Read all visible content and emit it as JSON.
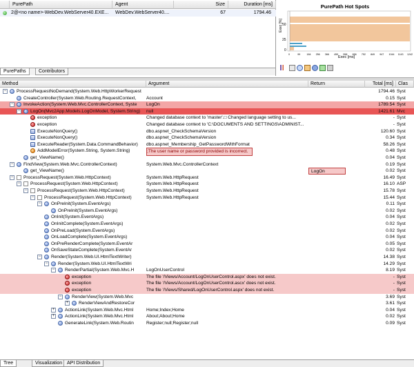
{
  "purepaths": {
    "columns": [
      "PurePath",
      "Agent",
      "Size",
      "Duration [ms]"
    ],
    "row": {
      "path": "2@<no name>-WebDev.WebServer40.EXE...",
      "agent": "WebDev.WebServer40....",
      "size": "67",
      "duration": "1794.46"
    },
    "tabs": [
      "PurePaths",
      "Contributors"
    ]
  },
  "hotspots": {
    "title": "PurePath Hot Spots",
    "ylabel": "Exec [%]",
    "xlabel": "Exec [ms]",
    "x_ticks": [
      "0",
      "99",
      "184",
      "256",
      "366",
      "459",
      "558",
      "656",
      "752",
      "849",
      "947",
      "1044",
      "1143",
      "1242"
    ]
  },
  "tree": {
    "columns": [
      "Method",
      "Argument",
      "Return",
      "Total [ms]",
      "Clas"
    ],
    "rows": [
      {
        "level": 0,
        "exp": "-",
        "icon": "ic",
        "method": "ProcessRequestNoDemand(System.Web.HttpWorkerRequest",
        "arg": "",
        "ret": "",
        "total": "1794.46",
        "cls": "Syst",
        "style": ""
      },
      {
        "level": 1,
        "exp": "",
        "icon": "ic",
        "method": "CreateController(System.Web.Routing.RequestContext,",
        "arg": "Account",
        "ret": "",
        "total": "0.15",
        "cls": "Syst",
        "style": ""
      },
      {
        "level": 1,
        "exp": "-",
        "icon": "ic",
        "method": "InvokeAction(System.Web.Mvc.ControllerContext, Syste",
        "arg": "LogOn",
        "ret": "",
        "total": "1789.54",
        "cls": "Syst",
        "style": "pink"
      },
      {
        "level": 2,
        "exp": "-",
        "icon": "ic",
        "method": "LogOn(Mvc2App.Models.LogOnModel, System.String)",
        "arg": "null",
        "ret": "",
        "total": "1421.61",
        "cls": "Mvc",
        "style": "sel"
      },
      {
        "level": 3,
        "exp": "",
        "icon": "ic-ex",
        "method": "exception",
        "arg": "Changed database context to 'master'.□ Changed language setting to us...",
        "ret": "",
        "total": "-",
        "cls": "Syst",
        "style": ""
      },
      {
        "level": 3,
        "exp": "",
        "icon": "ic-ex",
        "method": "exception",
        "arg": "Changed database context to 'C:\\DOCUMENTS AND SETTINGS\\ADMINIST...",
        "ret": "",
        "total": "-",
        "cls": "Syst",
        "style": ""
      },
      {
        "level": 3,
        "exp": "",
        "icon": "ic-db",
        "method": "ExecuteNonQuery()",
        "arg": "dbo.aspnet_CheckSchemaVersion",
        "ret": "",
        "total": "120.60",
        "cls": "Syst",
        "style": ""
      },
      {
        "level": 3,
        "exp": "",
        "icon": "ic-db",
        "method": "ExecuteNonQuery()",
        "arg": "dbo.aspnet_CheckSchemaVersion",
        "ret": "",
        "total": "0.34",
        "cls": "Syst",
        "style": ""
      },
      {
        "level": 3,
        "exp": "",
        "icon": "ic-db",
        "method": "ExecuteReader(System.Data.CommandBehavior)",
        "arg": "dbo.aspnet_Membership_GetPasswordWithFormat",
        "ret": "",
        "total": "58.26",
        "cls": "Syst",
        "style": ""
      },
      {
        "level": 3,
        "exp": "",
        "icon": "ic-err",
        "method": "AddModelError(System.String, System.String)",
        "arg": ";The user name or password provided is incorrect.",
        "ret": "",
        "total": "0.48",
        "cls": "Syst",
        "style": "argbox"
      },
      {
        "level": 2,
        "exp": "",
        "icon": "ic",
        "method": "get_ViewName()",
        "arg": "",
        "ret": "",
        "total": "0.04",
        "cls": "Syst",
        "style": ""
      },
      {
        "level": 1,
        "exp": "-",
        "icon": "ic",
        "method": "FindView(System.Web.Mvc.ControllerContext)",
        "arg": "System.Web.Mvc.ControllerContext",
        "ret": "",
        "total": "0.19",
        "cls": "Syst",
        "style": ""
      },
      {
        "level": 2,
        "exp": "",
        "icon": "ic",
        "method": "get_ViewName()",
        "arg": "",
        "ret": "LogOn",
        "total": "0.02",
        "cls": "Syst",
        "style": "retbox"
      },
      {
        "level": 1,
        "exp": "-",
        "icon": "ic-pg",
        "method": "ProcessRequest(System.Web.HttpContext)",
        "arg": "System.Web.HttpRequest",
        "ret": "",
        "total": "16.49",
        "cls": "Syst",
        "style": ""
      },
      {
        "level": 2,
        "exp": "-",
        "icon": "ic-pg",
        "method": "ProcessRequest(System.Web.HttpContext)",
        "arg": "System.Web.HttpRequest",
        "ret": "",
        "total": "16.10",
        "cls": "ASP",
        "style": ""
      },
      {
        "level": 3,
        "exp": "-",
        "icon": "ic-pg",
        "method": "ProcessRequest(System.Web.HttpContext)",
        "arg": "System.Web.HttpRequest",
        "ret": "",
        "total": "15.78",
        "cls": "Syst",
        "style": ""
      },
      {
        "level": 4,
        "exp": "-",
        "icon": "ic-pg",
        "method": "ProcessRequest(System.Web.HttpContext)",
        "arg": "System.Web.HttpRequest",
        "ret": "",
        "total": "15.44",
        "cls": "Syst",
        "style": ""
      },
      {
        "level": 5,
        "exp": "-",
        "icon": "ic",
        "method": "OnPreInit(System.EventArgs)",
        "arg": "",
        "ret": "",
        "total": "0.11",
        "cls": "Syst",
        "style": ""
      },
      {
        "level": 6,
        "exp": "",
        "icon": "ic",
        "method": "OnPreInit(System.EventArgs)",
        "arg": "",
        "ret": "",
        "total": "0.02",
        "cls": "Syst",
        "style": ""
      },
      {
        "level": 5,
        "exp": "",
        "icon": "ic",
        "method": "OnInit(System.EventArgs)",
        "arg": "",
        "ret": "",
        "total": "0.04",
        "cls": "Syst",
        "style": ""
      },
      {
        "level": 5,
        "exp": "",
        "icon": "ic",
        "method": "OnInitComplete(System.EventArgs)",
        "arg": "",
        "ret": "",
        "total": "0.02",
        "cls": "Syst",
        "style": ""
      },
      {
        "level": 5,
        "exp": "",
        "icon": "ic",
        "method": "OnPreLoad(System.EventArgs)",
        "arg": "",
        "ret": "",
        "total": "0.02",
        "cls": "Syst",
        "style": ""
      },
      {
        "level": 5,
        "exp": "",
        "icon": "ic",
        "method": "OnLoadComplete(System.EventArgs)",
        "arg": "",
        "ret": "",
        "total": "0.04",
        "cls": "Syst",
        "style": ""
      },
      {
        "level": 5,
        "exp": "",
        "icon": "ic",
        "method": "OnPreRenderComplete(System.EventAr",
        "arg": "",
        "ret": "",
        "total": "0.05",
        "cls": "Syst",
        "style": ""
      },
      {
        "level": 5,
        "exp": "",
        "icon": "ic",
        "method": "OnSaveStateComplete(System.EventAr",
        "arg": "",
        "ret": "",
        "total": "0.02",
        "cls": "Syst",
        "style": ""
      },
      {
        "level": 5,
        "exp": "-",
        "icon": "ic",
        "method": "Render(System.Web.UI.HtmlTextWriter)",
        "arg": "",
        "ret": "",
        "total": "14.38",
        "cls": "Syst",
        "style": ""
      },
      {
        "level": 6,
        "exp": "-",
        "icon": "ic",
        "method": "Render(System.Web.UI.HtmlTextWri",
        "arg": "",
        "ret": "",
        "total": "14.29",
        "cls": "Syst",
        "style": ""
      },
      {
        "level": 7,
        "exp": "-",
        "icon": "ic",
        "method": "RenderPartial(System.Web.Mvc.H",
        "arg": "LogOnUserControl",
        "ret": "",
        "total": "8.19",
        "cls": "Syst",
        "style": ""
      },
      {
        "level": 8,
        "exp": "",
        "icon": "ic-ex",
        "method": "exception",
        "arg": "The file '/Views/Account/LogOnUserControl.aspx' does not exist.",
        "ret": "",
        "total": "-",
        "cls": "Syst",
        "style": "light"
      },
      {
        "level": 8,
        "exp": "",
        "icon": "ic-ex",
        "method": "exception",
        "arg": "The file '/Views/Account/LogOnUserControl.ascx' does not exist.",
        "ret": "",
        "total": "-",
        "cls": "Syst",
        "style": "light"
      },
      {
        "level": 8,
        "exp": "",
        "icon": "ic-ex",
        "method": "exception",
        "arg": "The file '/Views/Shared/LogOnUserControl.aspx' does not exist.",
        "ret": "",
        "total": "-",
        "cls": "Syst",
        "style": "light"
      },
      {
        "level": 8,
        "exp": "-",
        "icon": "ic",
        "method": "RenderView(System.Web.Mvc",
        "arg": "",
        "ret": "",
        "total": "3.69",
        "cls": "Syst",
        "style": ""
      },
      {
        "level": 9,
        "exp": "+",
        "icon": "ic",
        "method": "RenderViewAndRestoreCor",
        "arg": "",
        "ret": "",
        "total": "3.61",
        "cls": "Syst",
        "style": ""
      },
      {
        "level": 7,
        "exp": "+",
        "icon": "ic",
        "method": "ActionLink(System.Web.Mvc.Html",
        "arg": "Home;Index;Home",
        "ret": "",
        "total": "0.04",
        "cls": "Syst",
        "style": ""
      },
      {
        "level": 7,
        "exp": "+",
        "icon": "ic",
        "method": "ActionLink(System.Web.Mvc.Html",
        "arg": "About;About;Home",
        "ret": "",
        "total": "0.02",
        "cls": "Syst",
        "style": ""
      },
      {
        "level": 7,
        "exp": "",
        "icon": "ic",
        "method": "GenerateLink(System.Web.Routin",
        "arg": "Register;null;Register;null",
        "ret": "",
        "total": "0.09",
        "cls": "Syst",
        "style": ""
      }
    ]
  },
  "bottom_tabs": [
    "Tree",
    "Visualization",
    "API Distribution"
  ],
  "colors": {
    "selected_row": "#e85555",
    "highlight_row": "#f3a6a6",
    "exception_row": "#f6c9c9",
    "hotspot_bar": "#f2c69c"
  }
}
